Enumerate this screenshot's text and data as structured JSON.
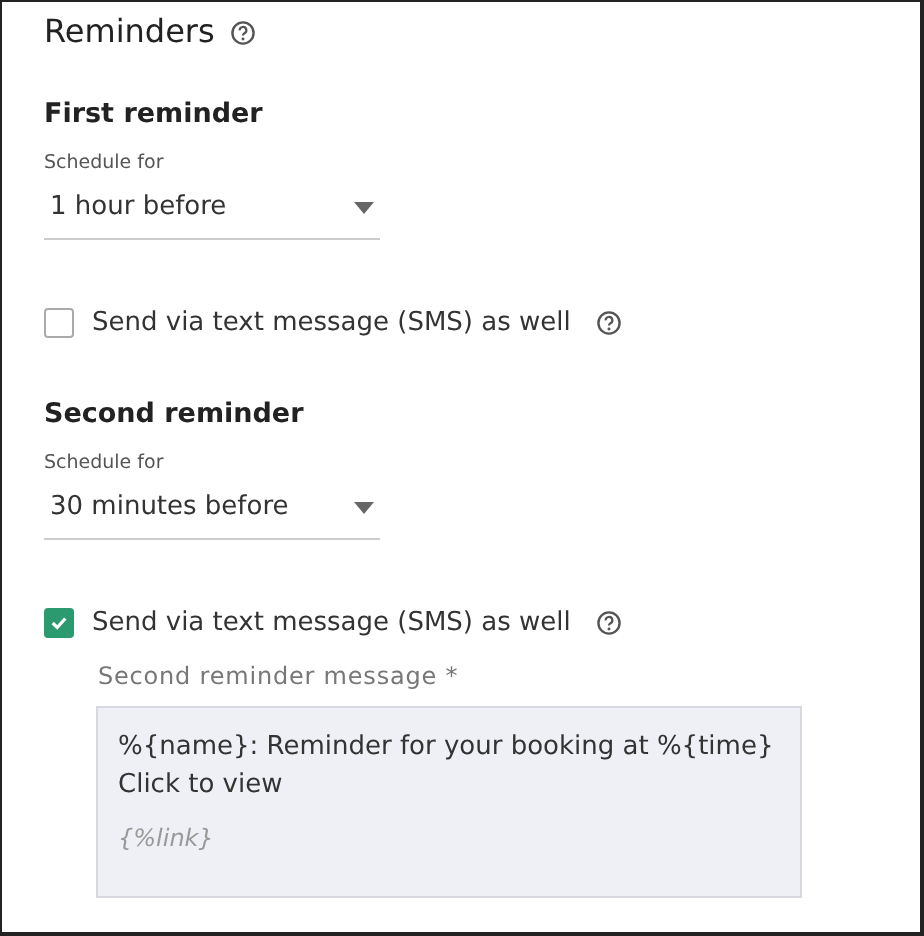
{
  "title": "Reminders",
  "reminders": [
    {
      "heading": "First reminder",
      "schedule_label": "Schedule for",
      "schedule_value": "1 hour before",
      "sms_label": "Send via text message (SMS) as well",
      "sms_checked": false
    },
    {
      "heading": "Second reminder",
      "schedule_label": "Schedule for",
      "schedule_value": "30 minutes before",
      "sms_label": "Send via text message (SMS) as well",
      "sms_checked": true,
      "message_label": "Second reminder message *",
      "message_lines": [
        "%{name}: Reminder for your booking at %{time}",
        "Click to view"
      ],
      "message_token": "{%link}"
    }
  ]
}
